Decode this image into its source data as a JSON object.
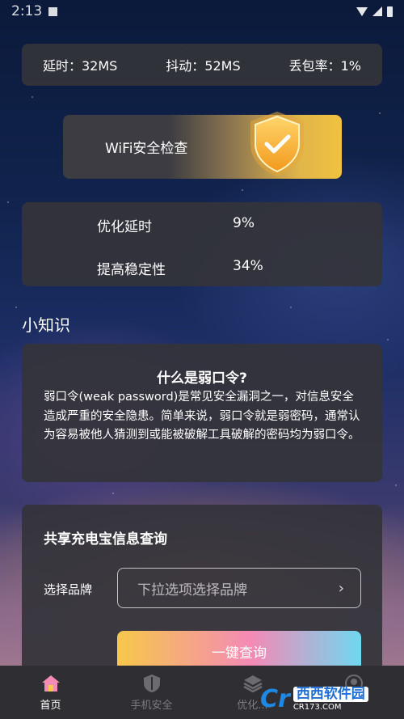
{
  "status_bar": {
    "time": "2:13"
  },
  "stats": {
    "latency": "延时：32MS",
    "jitter": "抖动：52MS",
    "packet_loss": "丢包率：1%"
  },
  "wifi_check": {
    "label": "WiFi安全检查"
  },
  "optimization": {
    "rows": [
      {
        "label": "优化延时",
        "value": "9%"
      },
      {
        "label": "提高稳定性",
        "value": "34%"
      }
    ]
  },
  "knowledge": {
    "section_title": "小知识",
    "title": "什么是弱口令?",
    "body": "弱口令(weak password)是常见安全漏洞之一，对信息安全造成严重的安全隐患。简单来说，弱口令就是弱密码，通常认为容易被他人猜测到或能被破解工具破解的密码均为弱口令。"
  },
  "power_bank": {
    "title": "共享充电宝信息查询",
    "brand_label": "选择品牌",
    "brand_placeholder": "下拉选项选择品牌",
    "query_button": "一键查询"
  },
  "bottom_nav": {
    "items": [
      {
        "label": "首页",
        "icon": "home-icon",
        "active": true
      },
      {
        "label": "手机安全",
        "icon": "shield-icon",
        "active": false
      },
      {
        "label": "优化...",
        "icon": "layers-icon",
        "active": false
      },
      {
        "label": "",
        "icon": "user-icon",
        "active": false
      }
    ]
  },
  "watermark": {
    "logo": "Cr",
    "name": "西西软件园",
    "url": "CR173.COM"
  },
  "colors": {
    "card_bg": "#343438",
    "accent_gold": "#f0c23f",
    "nav_active_icon": "#f48ab6",
    "nav_inactive": "#7c7c80"
  }
}
